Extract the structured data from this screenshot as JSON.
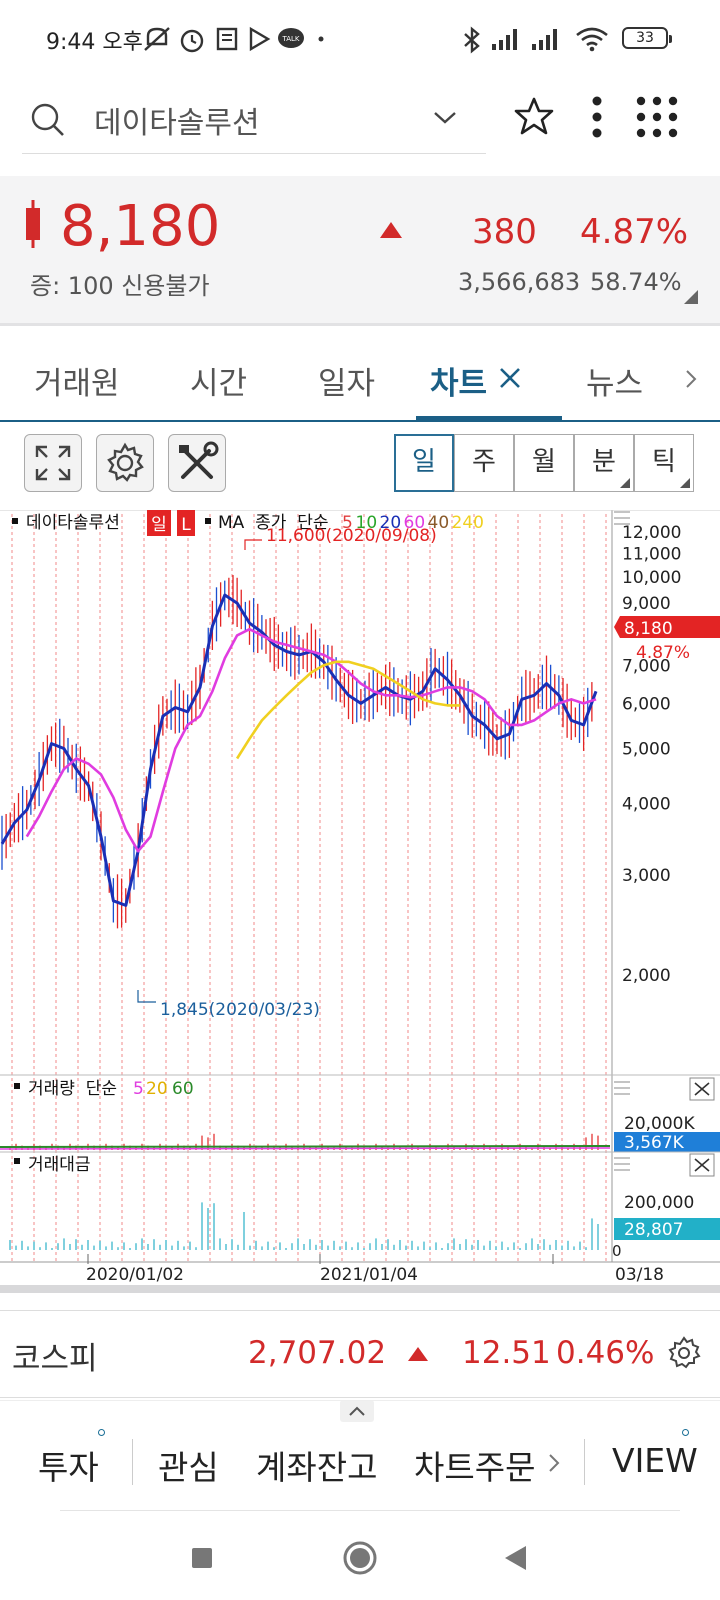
{
  "status_bar": {
    "time": "9:44 오후",
    "battery": "33",
    "icons": [
      "mute-icon",
      "alarm-icon",
      "notes-icon",
      "play-icon",
      "kakaotalk-icon",
      "chat-icon",
      "bluetooth-icon",
      "signal-icon",
      "signal-icon",
      "wifi-icon",
      "battery-icon"
    ]
  },
  "search": {
    "value": "데이타솔루션"
  },
  "quote": {
    "price": "8,180",
    "change": "380",
    "change_pct": "4.87%",
    "margin_info": "증: 100 신용불가",
    "volume": "3,566,683",
    "ratio": "58.74%"
  },
  "tabs": [
    {
      "label": "거래원"
    },
    {
      "label": "시간"
    },
    {
      "label": "일자"
    },
    {
      "label": "차트"
    },
    {
      "label": "뉴스"
    }
  ],
  "periods": [
    {
      "label": "일"
    },
    {
      "label": "주"
    },
    {
      "label": "월"
    },
    {
      "label": "분"
    },
    {
      "label": "틱"
    }
  ],
  "chart_data": {
    "type": "line",
    "scale": "log",
    "legend_title": "데이타솔루션",
    "period_badge": "일",
    "scale_badge": "L",
    "ma_label": "MA  종가  단순",
    "ma_periods": [
      {
        "value": "5",
        "color": "#e23c3c"
      },
      {
        "value": "10",
        "color": "#2aa52a"
      },
      {
        "value": "20",
        "color": "#1a2fb5"
      },
      {
        "value": "60",
        "color": "#e03ce0"
      },
      {
        "value": "40",
        "color": "#8a5a2a"
      },
      {
        "value": "240",
        "color": "#f0d020"
      }
    ],
    "y_ticks": [
      "12,000",
      "11,000",
      "10,000",
      "9,000",
      "7,000",
      "6,000",
      "5,000",
      "4,000",
      "3,000",
      "2,000"
    ],
    "y_tick_values": [
      12000,
      11000,
      10000,
      9000,
      7000,
      6000,
      5000,
      4000,
      3000,
      2000
    ],
    "ylim": [
      1600,
      13500
    ],
    "current_price_tag": "8,180",
    "current_value": 8180,
    "current_pct_tag": "4.87%",
    "max_annotation": "11,600(2020/09/08)",
    "max_value": 11600,
    "min_annotation": "1,845(2020/03/23)",
    "min_value": 1845,
    "x_labels": [
      "2020/01/02",
      "2021/01/04",
      "03/18"
    ],
    "series": [
      {
        "color": "#1a2fb5",
        "values": [
          3400,
          3700,
          3900,
          4400,
          5100,
          5000,
          4600,
          4300,
          3500,
          2700,
          2650,
          3300,
          4600,
          5700,
          5900,
          5800,
          6400,
          8200,
          9300,
          9000,
          8300,
          8000,
          7600,
          7400,
          7300,
          7400,
          7100,
          6600,
          6200,
          6000,
          6200,
          6400,
          6200,
          6100,
          6300,
          6900,
          6600,
          6200,
          5700,
          5500,
          5200,
          5300,
          6100,
          6200,
          6500,
          6200,
          5600,
          5500,
          6300
        ]
      },
      {
        "color": "#e03ce0",
        "values": [
          null,
          null,
          3500,
          3800,
          4200,
          4600,
          4800,
          4700,
          4500,
          4100,
          3600,
          3300,
          3500,
          4200,
          5000,
          5500,
          5700,
          6300,
          7200,
          7900,
          8100,
          7900,
          7700,
          7600,
          7500,
          7400,
          7300,
          7100,
          6800,
          6500,
          6300,
          6200,
          6200,
          6150,
          6200,
          6300,
          6400,
          6400,
          6300,
          6100,
          5700,
          5500,
          5500,
          5600,
          5800,
          6000,
          6100,
          6000,
          6100
        ]
      },
      {
        "color": "#f0d020",
        "values": [
          null,
          null,
          null,
          null,
          null,
          null,
          null,
          null,
          null,
          null,
          null,
          null,
          null,
          null,
          null,
          null,
          null,
          null,
          null,
          4800,
          5200,
          5600,
          5900,
          6200,
          6500,
          6800,
          7000,
          7100,
          7100,
          7000,
          6900,
          6700,
          6500,
          6300,
          6100,
          6000,
          5950,
          5950
        ]
      }
    ],
    "volume_panel": {
      "label": "거래량  단순",
      "ma": [
        "5",
        "20",
        "60"
      ],
      "tick": "20,000K",
      "current": "3,567K"
    },
    "amount_panel": {
      "label": "거래대금",
      "tick": "200,000",
      "current": "28,807",
      "zero": "0"
    }
  },
  "index": {
    "name": "코스피",
    "value": "2,707.02",
    "change": "12.51",
    "pct": "0.46%"
  },
  "bottom_nav": [
    {
      "label": "투자"
    },
    {
      "label": "관심"
    },
    {
      "label": "계좌잔고"
    },
    {
      "label": "차트주문"
    },
    {
      "label": "VIEW"
    }
  ]
}
